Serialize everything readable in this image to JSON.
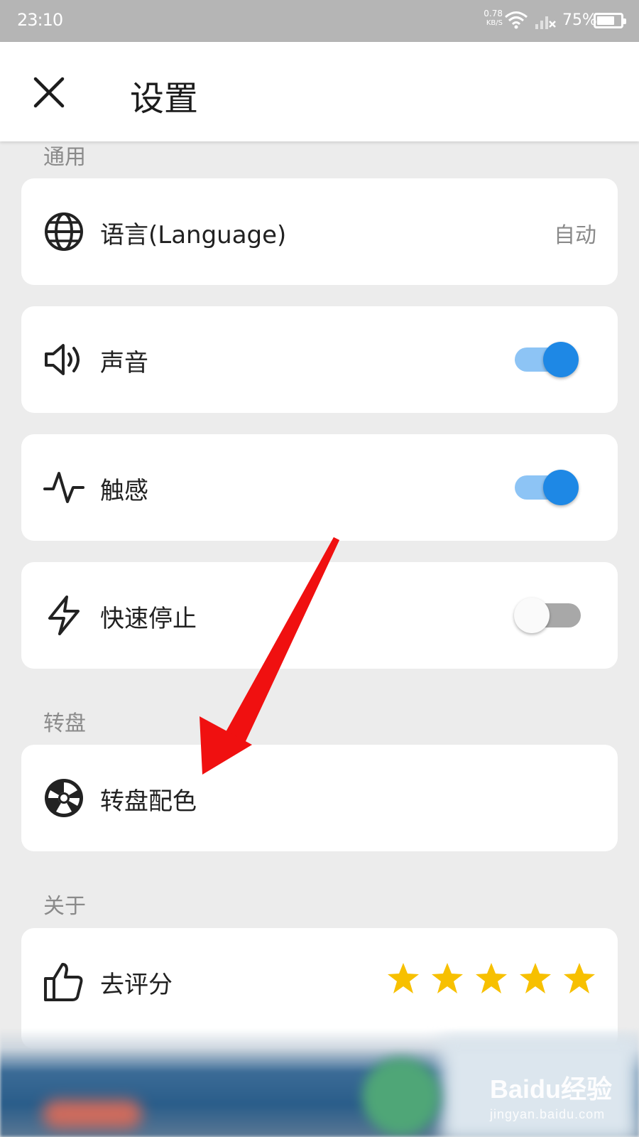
{
  "status_bar": {
    "time": "23:10",
    "net_speed": "0.78",
    "net_unit": "KB/S",
    "battery_percent": "75%",
    "battery_level": 0.75
  },
  "header": {
    "title": "设置",
    "close_icon": "close-icon"
  },
  "sections": {
    "general": {
      "label": "通用",
      "language": {
        "label": "语言(Language)",
        "value": "自动",
        "icon": "globe-icon"
      },
      "sound": {
        "label": "声音",
        "icon": "speaker-icon",
        "enabled": true
      },
      "haptics": {
        "label": "触感",
        "icon": "pulse-icon",
        "enabled": true
      },
      "quick_stop": {
        "label": "快速停止",
        "icon": "lightning-icon",
        "enabled": false
      }
    },
    "wheel": {
      "label": "转盘",
      "wheel_colors": {
        "label": "转盘配色",
        "icon": "wheel-icon"
      }
    },
    "about": {
      "label": "关于",
      "rate": {
        "label": "去评分",
        "icon": "thumbs-up-icon",
        "stars": 5
      }
    }
  },
  "colors": {
    "toggle_on": "#1e88e5",
    "toggle_on_track": "#8dc4f5",
    "star": "#f7c000",
    "arrow": "#f01010"
  },
  "watermark": {
    "line1": "Baidu经验",
    "line2": "jingyan.baidu.com"
  }
}
